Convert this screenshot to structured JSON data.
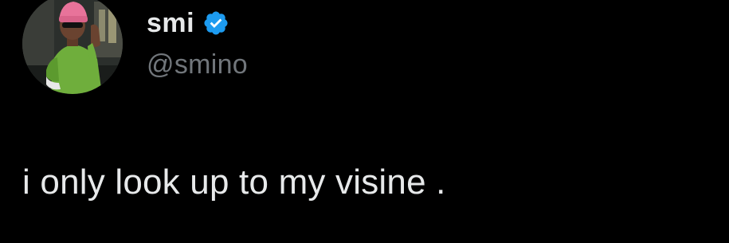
{
  "author": {
    "display_name": "smi",
    "handle": "@smino",
    "verified_icon": "verified-badge-icon",
    "avatar_icon": "profile-photo"
  },
  "tweet": {
    "text": "i only look up to my visine ."
  },
  "colors": {
    "background": "#000000",
    "primary_text": "#e7e9ea",
    "secondary_text": "#71767b",
    "verified_blue": "#1d9bf0"
  }
}
